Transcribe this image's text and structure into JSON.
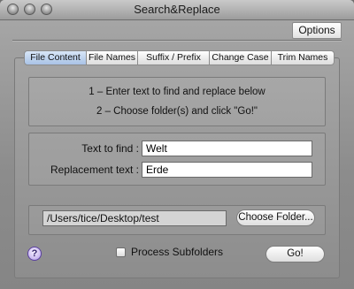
{
  "window": {
    "title": "Search&Replace"
  },
  "toolbar": {
    "options_label": "Options"
  },
  "tabs": [
    {
      "label": "File Content",
      "active": true
    },
    {
      "label": "File Names",
      "active": false
    },
    {
      "label": "Suffix / Prefix",
      "active": false
    },
    {
      "label": "Change Case",
      "active": false
    },
    {
      "label": "Trim Names",
      "active": false
    }
  ],
  "instructions": {
    "line1": "1 – Enter text to find and replace below",
    "line2": "2 – Choose folder(s) and click \"Go!\""
  },
  "fields": {
    "find_label": "Text to find :",
    "find_value": "Welt",
    "replace_label": "Replacement text :",
    "replace_value": "Erde"
  },
  "folder": {
    "path": "/Users/tice/Desktop/test",
    "choose_label": "Choose Folder..."
  },
  "bottom": {
    "help_glyph": "?",
    "process_subfolders_label": "Process Subfolders",
    "process_subfolders_checked": false,
    "go_label": "Go!"
  }
}
